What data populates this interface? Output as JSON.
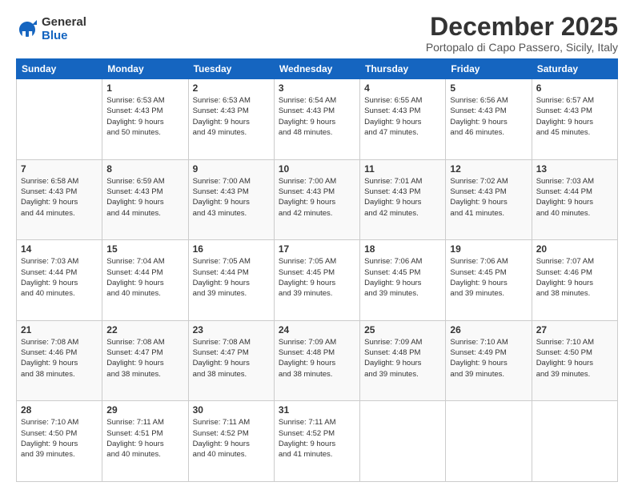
{
  "logo": {
    "general": "General",
    "blue": "Blue"
  },
  "header": {
    "month": "December 2025",
    "location": "Portopalo di Capo Passero, Sicily, Italy"
  },
  "weekdays": [
    "Sunday",
    "Monday",
    "Tuesday",
    "Wednesday",
    "Thursday",
    "Friday",
    "Saturday"
  ],
  "weeks": [
    [
      {
        "day": "",
        "info": ""
      },
      {
        "day": "1",
        "info": "Sunrise: 6:53 AM\nSunset: 4:43 PM\nDaylight: 9 hours\nand 50 minutes."
      },
      {
        "day": "2",
        "info": "Sunrise: 6:53 AM\nSunset: 4:43 PM\nDaylight: 9 hours\nand 49 minutes."
      },
      {
        "day": "3",
        "info": "Sunrise: 6:54 AM\nSunset: 4:43 PM\nDaylight: 9 hours\nand 48 minutes."
      },
      {
        "day": "4",
        "info": "Sunrise: 6:55 AM\nSunset: 4:43 PM\nDaylight: 9 hours\nand 47 minutes."
      },
      {
        "day": "5",
        "info": "Sunrise: 6:56 AM\nSunset: 4:43 PM\nDaylight: 9 hours\nand 46 minutes."
      },
      {
        "day": "6",
        "info": "Sunrise: 6:57 AM\nSunset: 4:43 PM\nDaylight: 9 hours\nand 45 minutes."
      }
    ],
    [
      {
        "day": "7",
        "info": "Sunrise: 6:58 AM\nSunset: 4:43 PM\nDaylight: 9 hours\nand 44 minutes."
      },
      {
        "day": "8",
        "info": "Sunrise: 6:59 AM\nSunset: 4:43 PM\nDaylight: 9 hours\nand 44 minutes."
      },
      {
        "day": "9",
        "info": "Sunrise: 7:00 AM\nSunset: 4:43 PM\nDaylight: 9 hours\nand 43 minutes."
      },
      {
        "day": "10",
        "info": "Sunrise: 7:00 AM\nSunset: 4:43 PM\nDaylight: 9 hours\nand 42 minutes."
      },
      {
        "day": "11",
        "info": "Sunrise: 7:01 AM\nSunset: 4:43 PM\nDaylight: 9 hours\nand 42 minutes."
      },
      {
        "day": "12",
        "info": "Sunrise: 7:02 AM\nSunset: 4:43 PM\nDaylight: 9 hours\nand 41 minutes."
      },
      {
        "day": "13",
        "info": "Sunrise: 7:03 AM\nSunset: 4:44 PM\nDaylight: 9 hours\nand 40 minutes."
      }
    ],
    [
      {
        "day": "14",
        "info": "Sunrise: 7:03 AM\nSunset: 4:44 PM\nDaylight: 9 hours\nand 40 minutes."
      },
      {
        "day": "15",
        "info": "Sunrise: 7:04 AM\nSunset: 4:44 PM\nDaylight: 9 hours\nand 40 minutes."
      },
      {
        "day": "16",
        "info": "Sunrise: 7:05 AM\nSunset: 4:44 PM\nDaylight: 9 hours\nand 39 minutes."
      },
      {
        "day": "17",
        "info": "Sunrise: 7:05 AM\nSunset: 4:45 PM\nDaylight: 9 hours\nand 39 minutes."
      },
      {
        "day": "18",
        "info": "Sunrise: 7:06 AM\nSunset: 4:45 PM\nDaylight: 9 hours\nand 39 minutes."
      },
      {
        "day": "19",
        "info": "Sunrise: 7:06 AM\nSunset: 4:45 PM\nDaylight: 9 hours\nand 39 minutes."
      },
      {
        "day": "20",
        "info": "Sunrise: 7:07 AM\nSunset: 4:46 PM\nDaylight: 9 hours\nand 38 minutes."
      }
    ],
    [
      {
        "day": "21",
        "info": "Sunrise: 7:08 AM\nSunset: 4:46 PM\nDaylight: 9 hours\nand 38 minutes."
      },
      {
        "day": "22",
        "info": "Sunrise: 7:08 AM\nSunset: 4:47 PM\nDaylight: 9 hours\nand 38 minutes."
      },
      {
        "day": "23",
        "info": "Sunrise: 7:08 AM\nSunset: 4:47 PM\nDaylight: 9 hours\nand 38 minutes."
      },
      {
        "day": "24",
        "info": "Sunrise: 7:09 AM\nSunset: 4:48 PM\nDaylight: 9 hours\nand 38 minutes."
      },
      {
        "day": "25",
        "info": "Sunrise: 7:09 AM\nSunset: 4:48 PM\nDaylight: 9 hours\nand 39 minutes."
      },
      {
        "day": "26",
        "info": "Sunrise: 7:10 AM\nSunset: 4:49 PM\nDaylight: 9 hours\nand 39 minutes."
      },
      {
        "day": "27",
        "info": "Sunrise: 7:10 AM\nSunset: 4:50 PM\nDaylight: 9 hours\nand 39 minutes."
      }
    ],
    [
      {
        "day": "28",
        "info": "Sunrise: 7:10 AM\nSunset: 4:50 PM\nDaylight: 9 hours\nand 39 minutes."
      },
      {
        "day": "29",
        "info": "Sunrise: 7:11 AM\nSunset: 4:51 PM\nDaylight: 9 hours\nand 40 minutes."
      },
      {
        "day": "30",
        "info": "Sunrise: 7:11 AM\nSunset: 4:52 PM\nDaylight: 9 hours\nand 40 minutes."
      },
      {
        "day": "31",
        "info": "Sunrise: 7:11 AM\nSunset: 4:52 PM\nDaylight: 9 hours\nand 41 minutes."
      },
      {
        "day": "",
        "info": ""
      },
      {
        "day": "",
        "info": ""
      },
      {
        "day": "",
        "info": ""
      }
    ]
  ]
}
